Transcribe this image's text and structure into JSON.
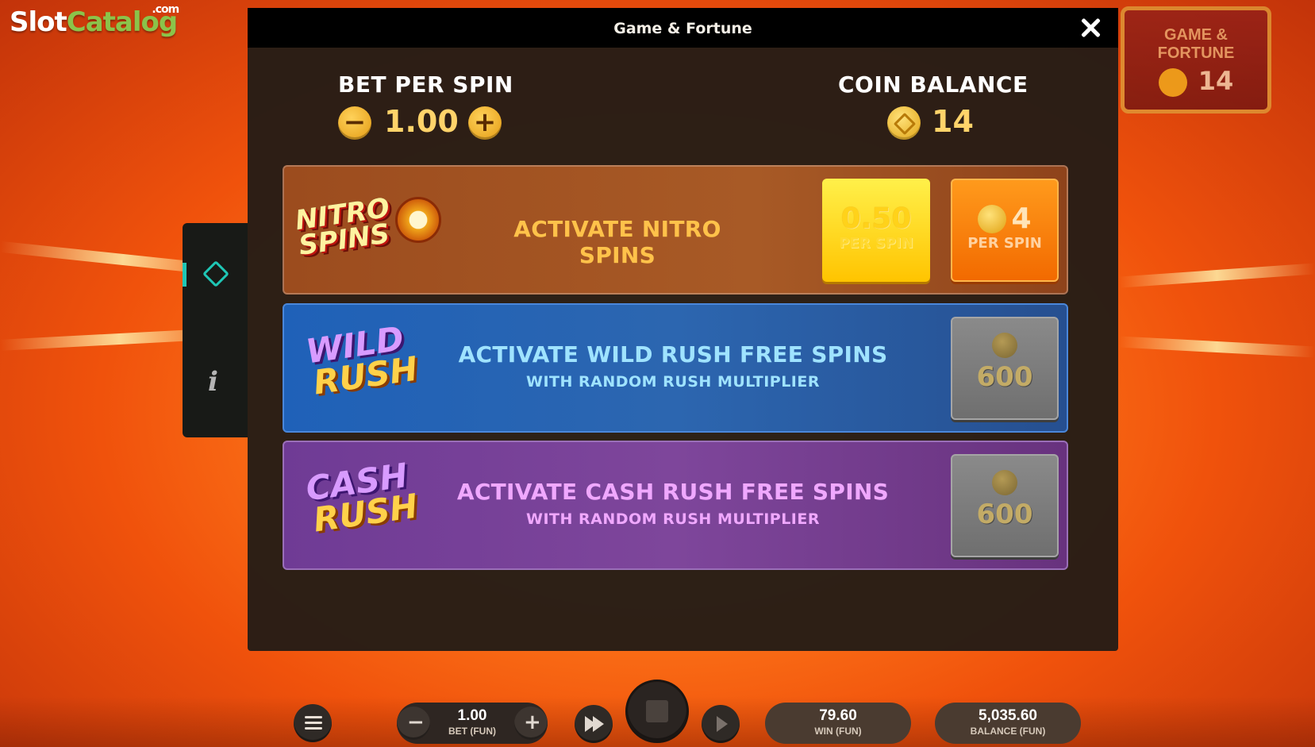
{
  "watermark": {
    "brand_part1": "Slot",
    "brand_part2": "Catalog",
    "brand_suffix": ".com"
  },
  "background_badge": {
    "title_line1": "GAME &",
    "title_line2": "FORTUNE",
    "value": "14"
  },
  "modal": {
    "title": "Game & Fortune",
    "bet": {
      "label": "BET PER SPIN",
      "value": "1.00",
      "minus": "−",
      "plus": "+"
    },
    "balance": {
      "label": "COIN BALANCE",
      "value": "14"
    },
    "features": [
      {
        "logo_line1": "NITRO",
        "logo_line2": "SPINS",
        "title": "ACTIVATE NITRO SPINS",
        "subtitle": "",
        "tiles": [
          {
            "value": "0.50",
            "label": "PER SPIN",
            "style": "yellow"
          },
          {
            "value": "4",
            "label": "PER SPIN",
            "style": "orange"
          }
        ]
      },
      {
        "logo_line1": "WILD",
        "logo_line2": "RUSH",
        "title": "ACTIVATE WILD RUSH FREE SPINS",
        "subtitle": "WITH RANDOM RUSH MULTIPLIER",
        "tiles": [
          {
            "value": "600",
            "style": "gray"
          }
        ]
      },
      {
        "logo_line1": "CASH",
        "logo_line2": "RUSH",
        "title": "ACTIVATE CASH RUSH FREE SPINS",
        "subtitle": "WITH RANDOM RUSH MULTIPLIER",
        "tiles": [
          {
            "value": "600",
            "style": "gray"
          }
        ]
      }
    ]
  },
  "side_panel": {
    "info_glyph": "i"
  },
  "bottom_bar": {
    "bet": {
      "value": "1.00",
      "label": "BET (FUN)"
    },
    "win": {
      "value": "79.60",
      "label": "WIN (FUN)"
    },
    "balance": {
      "value": "5,035.60",
      "label": "BALANCE (FUN)"
    },
    "minus": "−",
    "plus": "+"
  },
  "colors": {
    "accent_gold": "#ffd36a",
    "nitro_bg": "#a85a26",
    "wild_bg": "#2c66b0",
    "cash_bg": "#7e469b",
    "side_accent": "#1fc7b6"
  }
}
